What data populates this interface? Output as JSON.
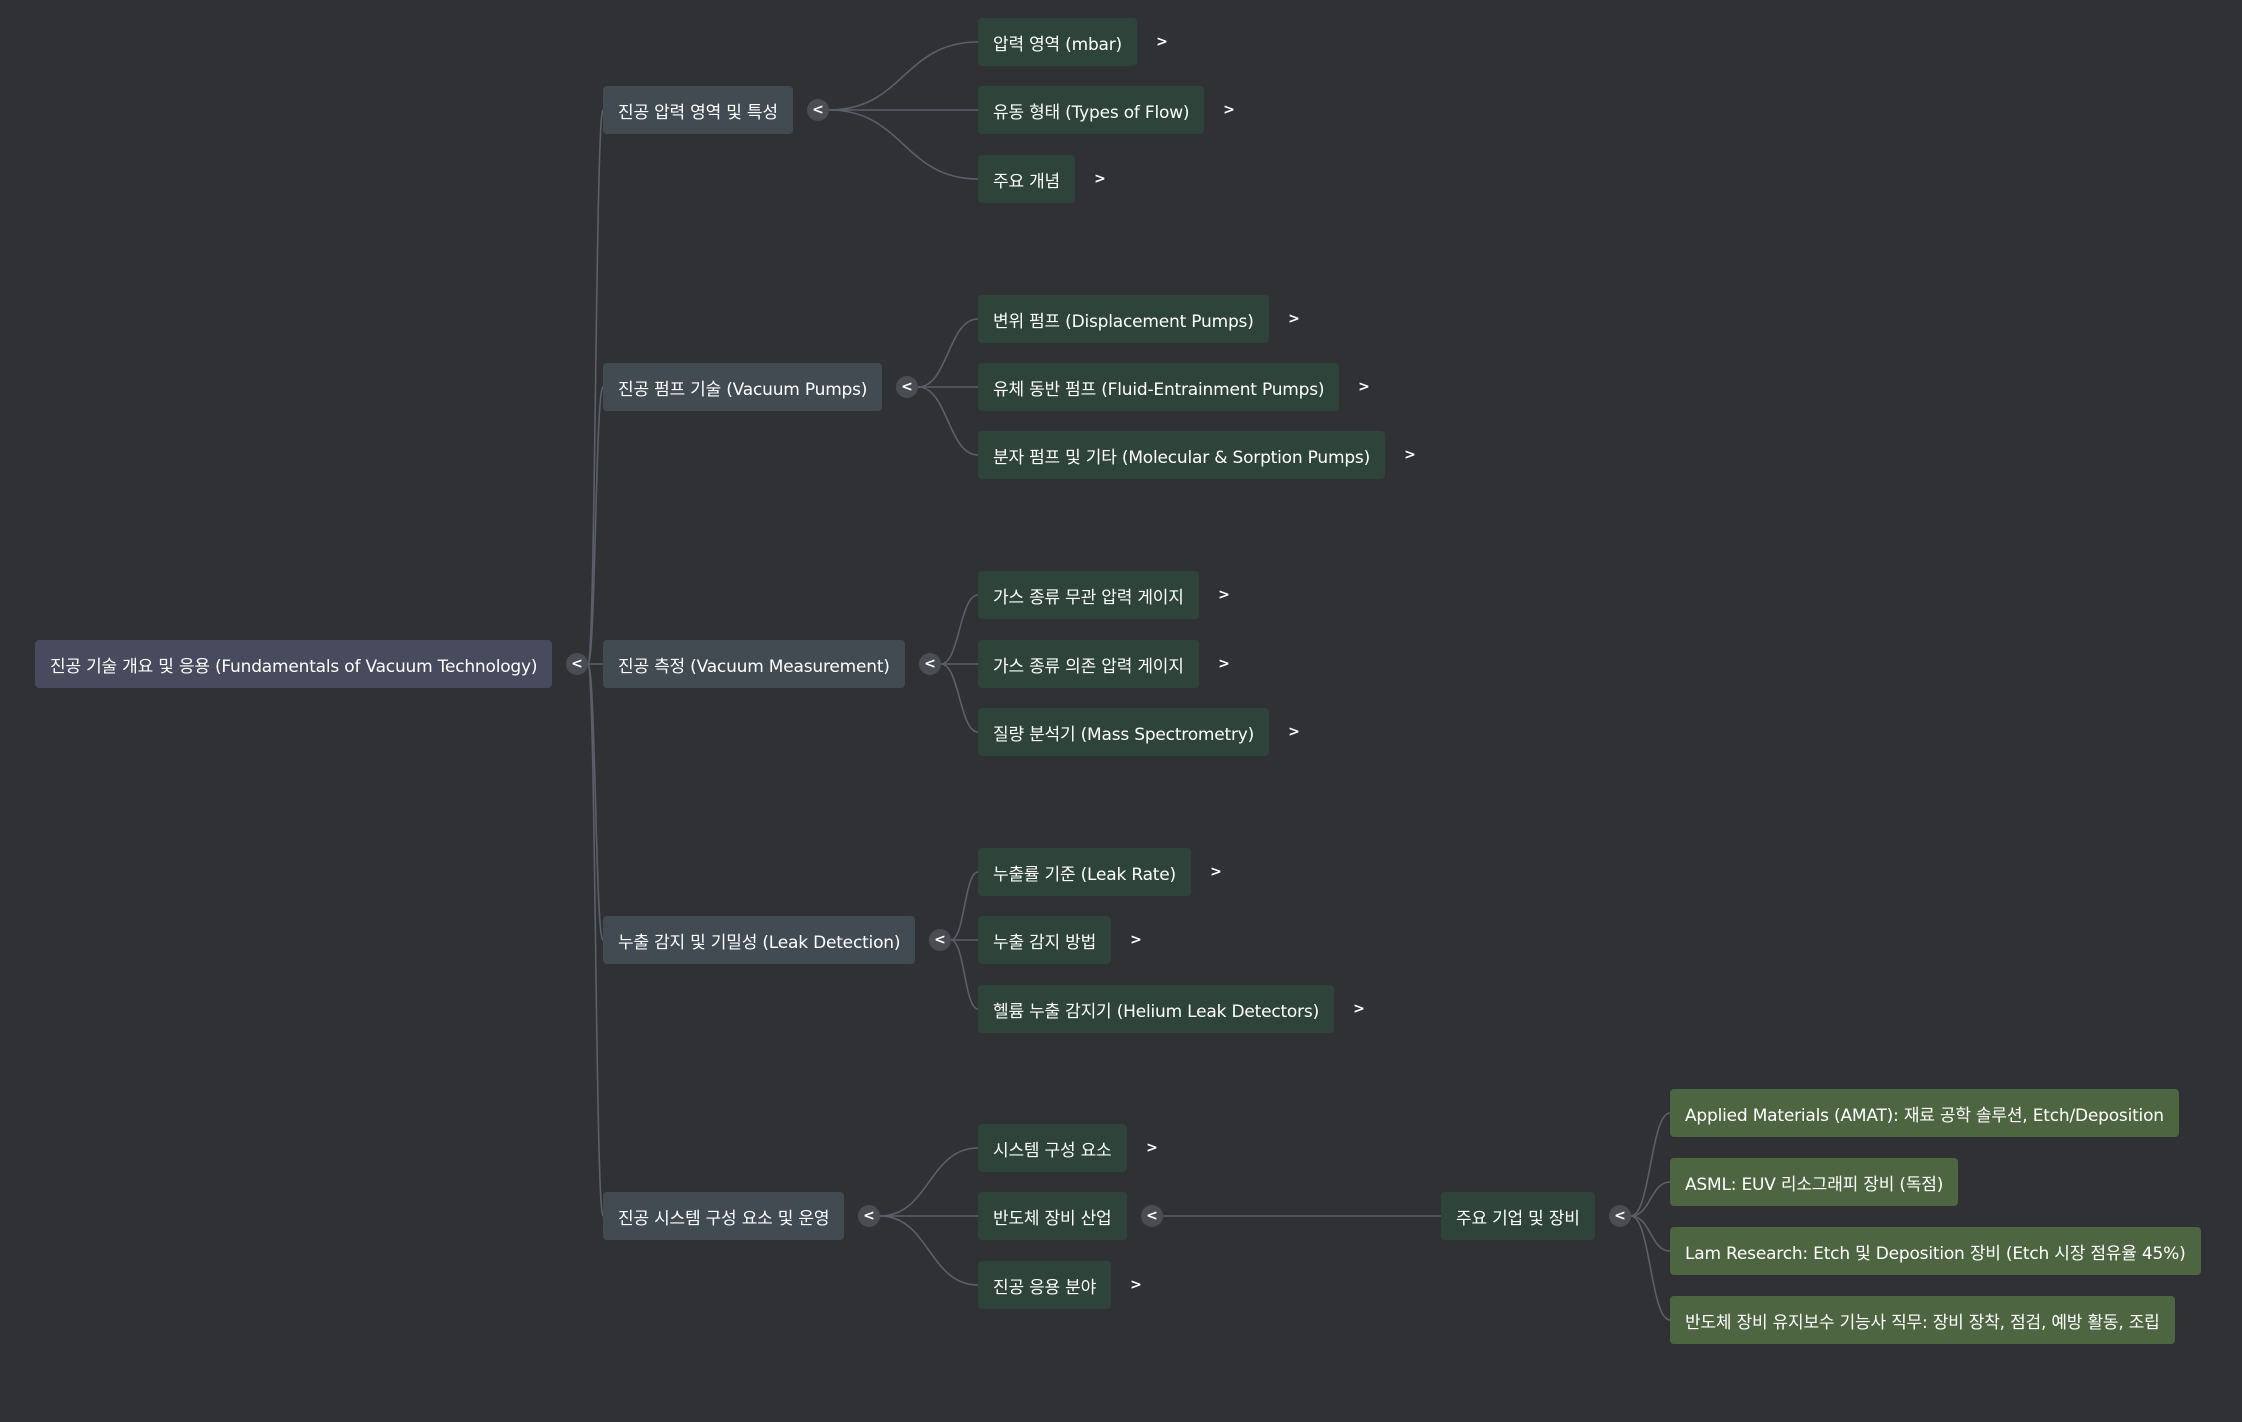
{
  "mindmap": {
    "root": {
      "label": "진공 기술 개요 및 응용 (Fundamentals of Vacuum Technology)",
      "toggle": "<"
    },
    "branches": [
      {
        "label": "진공 압력 영역 및 특성",
        "toggle": "<",
        "children": [
          {
            "label": "압력 영역 (mbar)",
            "toggle": ">"
          },
          {
            "label": "유동 형태 (Types of Flow)",
            "toggle": ">"
          },
          {
            "label": "주요 개념",
            "toggle": ">"
          }
        ]
      },
      {
        "label": "진공 펌프 기술 (Vacuum Pumps)",
        "toggle": "<",
        "children": [
          {
            "label": "변위 펌프 (Displacement Pumps)",
            "toggle": ">"
          },
          {
            "label": "유체 동반 펌프 (Fluid-Entrainment Pumps)",
            "toggle": ">"
          },
          {
            "label": "분자 펌프 및 기타 (Molecular & Sorption Pumps)",
            "toggle": ">"
          }
        ]
      },
      {
        "label": "진공 측정 (Vacuum Measurement)",
        "toggle": "<",
        "children": [
          {
            "label": "가스 종류 무관 압력 게이지",
            "toggle": ">"
          },
          {
            "label": "가스 종류 의존 압력 게이지",
            "toggle": ">"
          },
          {
            "label": "질량 분석기 (Mass Spectrometry)",
            "toggle": ">"
          }
        ]
      },
      {
        "label": "누출 감지 및 기밀성 (Leak Detection)",
        "toggle": "<",
        "children": [
          {
            "label": "누출률 기준 (Leak Rate)",
            "toggle": ">"
          },
          {
            "label": "누출 감지 방법",
            "toggle": ">"
          },
          {
            "label": "헬륨 누출 감지기 (Helium Leak Detectors)",
            "toggle": ">"
          }
        ]
      },
      {
        "label": "진공 시스템 구성 요소 및 운영",
        "toggle": "<",
        "children": [
          {
            "label": "시스템 구성 요소",
            "toggle": ">"
          },
          {
            "label": "반도체 장비 산업",
            "toggle": "<",
            "children": [
              {
                "label": "주요 기업 및 장비",
                "toggle": "<",
                "children": [
                  {
                    "label": "Applied Materials (AMAT): 재료 공학 솔루션, Etch/Deposition"
                  },
                  {
                    "label": "ASML: EUV 리소그래피 장비 (독점)"
                  },
                  {
                    "label": "Lam Research: Etch 및 Deposition 장비 (Etch 시장 점유율 45%)"
                  },
                  {
                    "label": "반도체 장비 유지보수 기능사 직무: 장비 장착, 점검, 예방 활동, 조립"
                  }
                ]
              }
            ]
          },
          {
            "label": "진공 응용 분야",
            "toggle": ">"
          }
        ]
      }
    ]
  },
  "colors": {
    "background": "#303134",
    "root_node": "#484a5d",
    "branch_node": "#424a52",
    "leaf_node": "#2e4339",
    "company_node": "#4e6541",
    "edge": "#5a5f6a",
    "text": "#ffffff"
  }
}
